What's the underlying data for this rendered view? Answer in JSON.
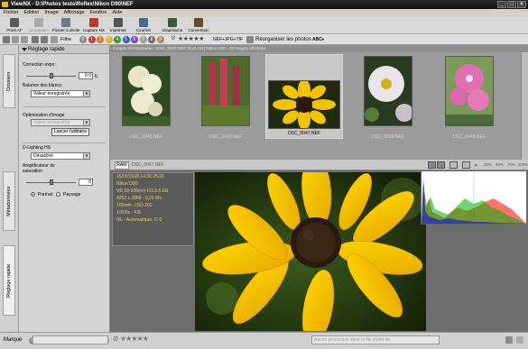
{
  "window": {
    "title": "ViewNX - D:\\Photos tests\\Reflex\\Nikon D90\\NEF"
  },
  "menu": [
    "Fichier",
    "Edition",
    "Image",
    "Affichage",
    "Fenêtre",
    "Aide"
  ],
  "toolbar": [
    {
      "label": "Point AF",
      "icon": "af-point-icon",
      "enabled": true
    },
    {
      "label": "Annotation",
      "icon": "annotation-icon",
      "enabled": false
    },
    {
      "label": "Pivoter à droite",
      "icon": "rotate-right-icon",
      "enabled": true
    },
    {
      "label": "Capture NX",
      "icon": "capture-nx-icon",
      "enabled": true
    },
    {
      "label": "Imprimer",
      "icon": "print-icon",
      "enabled": true
    },
    {
      "label": "Courrier électron.",
      "icon": "mail-icon",
      "enabled": true
    },
    {
      "label": "Diaporama",
      "icon": "slideshow-icon",
      "enabled": true
    },
    {
      "label": "Conversion",
      "icon": "convert-icon",
      "enabled": true
    }
  ],
  "filterbar": {
    "filter_label": "Filtre",
    "labels": [
      "0",
      "1",
      "2",
      "3",
      "4",
      "5",
      "6",
      "7",
      "8",
      "9"
    ],
    "label_colors": [
      "#888888",
      "#d23a3a",
      "#e6732a",
      "#d8b820",
      "#2f9a3a",
      "#2b5fc8",
      "#7c48c4",
      "#a0a0a0",
      "#6a6a6a",
      "#b08a50"
    ],
    "stars": "★★★★★",
    "filetypes": "NEF+JPG+TIF",
    "sort_label": "Réorganiser les photos",
    "sort_value": "ABC"
  },
  "sidetabs": {
    "dossiers": "Dossiers",
    "metadonnees": "Métadonnées",
    "reglage": "Réglage rapide"
  },
  "adjust": {
    "title": "Réglage rapide",
    "exposure_label": "Correction expo.",
    "exposure_value": "0.0",
    "exposure_unit": "IL",
    "wb_label": "Balance des blancs",
    "wb_value": "Valeur enregistrée",
    "optim_label": "Optimisation d'image",
    "optim_value": "Valeur enregistrée",
    "launch_button": "Lancer l'utilitaire",
    "dlighting_label": "D-Lighting HS",
    "dlighting_value": "Désactivé",
    "saturation_label": "Amplificateur de saturation",
    "saturation_value": "0",
    "portrait_label": "Portrait",
    "landscape_label": "Paysage"
  },
  "thumbnails": {
    "header": "Images sélectionnées : DSC_0047.NEF (9,21 Mo) Nikon D90 - 23 images affichées",
    "items": [
      {
        "name": "DSC_0043.NEF",
        "selected": false
      },
      {
        "name": "DSC_0045.NEF",
        "selected": false
      },
      {
        "name": "DSC_0047.NEF",
        "selected": true
      },
      {
        "name": "DSC_0048.NEF",
        "selected": false
      },
      {
        "name": "DSC_0049.NEF",
        "selected": false
      }
    ]
  },
  "viewer": {
    "tab": "RAW",
    "filename": "DSC_0047.NEF",
    "zoom_levels": [
      "25%",
      "50%",
      "75%",
      "100%"
    ],
    "info": [
      "16/09/2008 14:36:25.00",
      "Nikon D90",
      "VR 18-105mm F/3.5-5.6G",
      "4352 x 2868 - 9,21 Mo",
      "105mm - ISO 200",
      "1/200s - F/8",
      "0IL - Automatique, 0, 0"
    ]
  },
  "statusbar": {
    "marque_label": "Marque",
    "queue_text": "Aucun processus dans la file d'attente"
  }
}
